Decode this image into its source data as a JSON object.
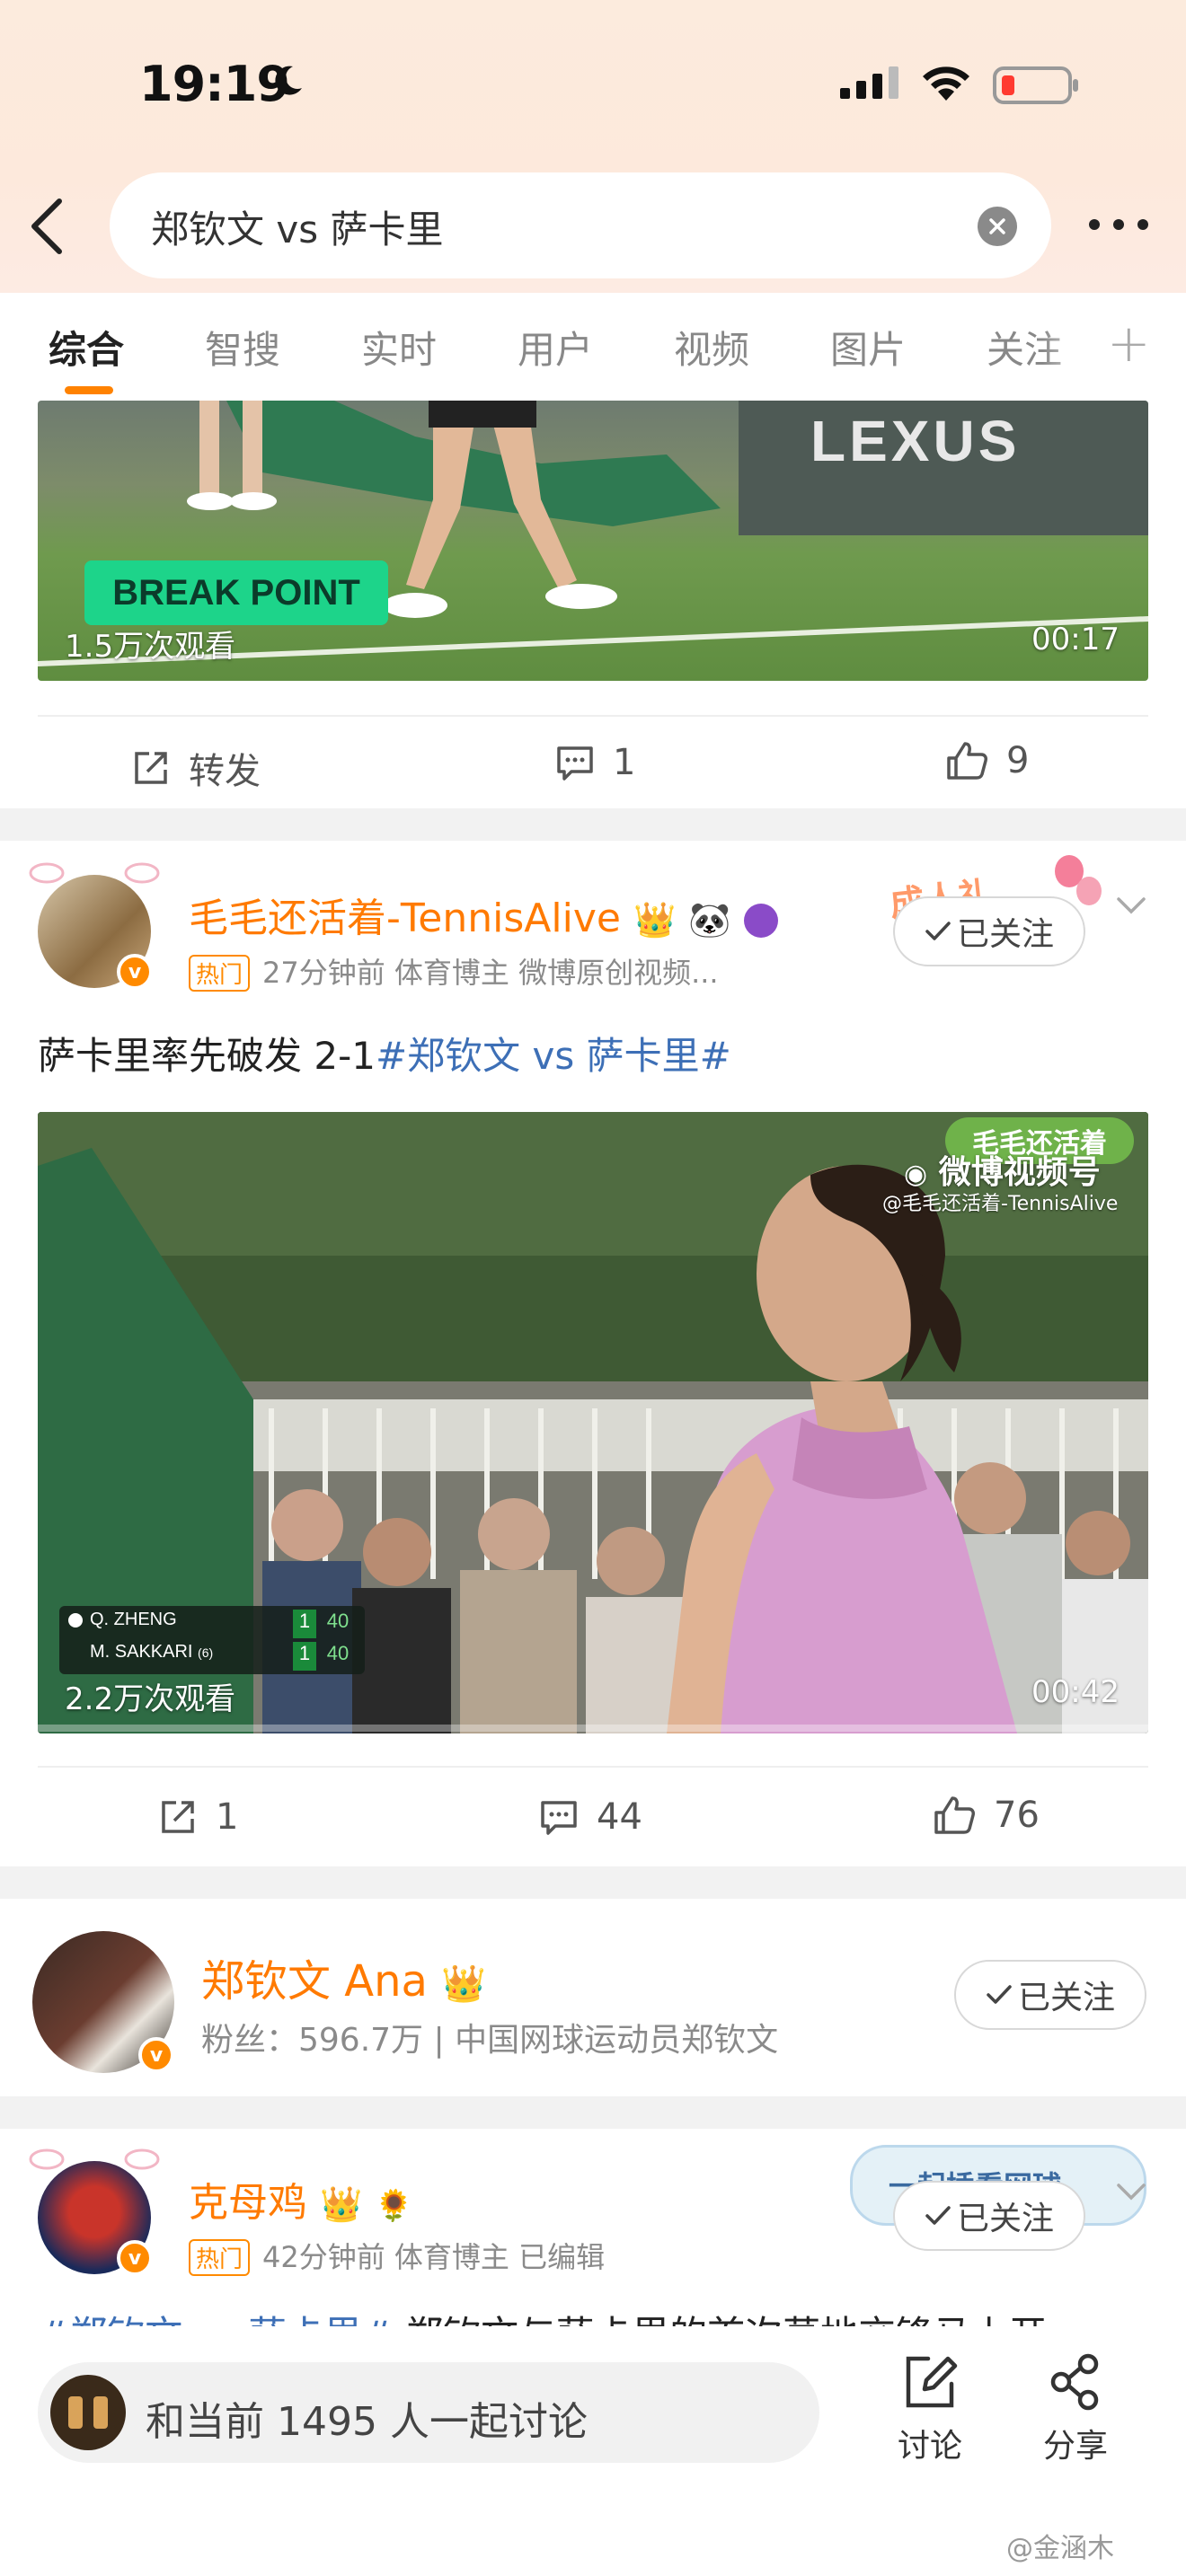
{
  "status_bar": {
    "time": "19:19"
  },
  "search": {
    "query": "郑钦文 vs 萨卡里"
  },
  "tabs": [
    {
      "label": "综合",
      "active": true
    },
    {
      "label": "智搜"
    },
    {
      "label": "实时"
    },
    {
      "label": "用户"
    },
    {
      "label": "视频"
    },
    {
      "label": "图片"
    },
    {
      "label": "关注"
    }
  ],
  "post1": {
    "video": {
      "overlay_label": "BREAK POINT",
      "brand": "LEXUS",
      "views": "1.5万次观看",
      "duration": "00:17"
    },
    "actions": {
      "repost": "转发",
      "comments": "1",
      "likes": "9"
    }
  },
  "post2": {
    "username": "毛毛还活着-TennisAlive",
    "hot_tag": "热门",
    "meta": "27分钟前  体育博主 微博原创视频...",
    "follow": "已关注",
    "deco": "成人礼",
    "text_plain": "萨卡里率先破发 2-1",
    "text_topic": "#郑钦文 vs 萨卡里#",
    "video": {
      "watermark_top": "毛毛还活着",
      "watermark_channel": "微博视频号",
      "watermark_handle": "@毛毛还活着-TennisAlive",
      "score_p1": "Q. ZHENG",
      "score_p2": "M. SAKKARI",
      "score_p2_seed": "(6)",
      "score_sets_p1": "1",
      "score_sets_p2": "1",
      "score_game_p1": "40",
      "score_game_p2": "40",
      "views": "2.2万次观看",
      "duration": "00:42"
    },
    "actions": {
      "reposts": "1",
      "comments": "44",
      "likes": "76"
    }
  },
  "user_card": {
    "name": "郑钦文 Ana",
    "fans": "粉丝：596.7万 | 中国网球运动员郑钦文",
    "follow": "已关注"
  },
  "post3": {
    "username": "克母鸡",
    "hot_tag": "热门",
    "meta": "42分钟前  体育博主 已编辑",
    "follow": "已关注",
    "deco": "一起捶看网球",
    "text_topic": "#郑钦文 vs 萨卡里#",
    "text_plain": " 郑钦文与萨卡里的首次草地交锋马上开"
  },
  "bottom_bar": {
    "discuss_placeholder": "和当前 1495 人一起讨论",
    "discuss_label": "讨论",
    "share_label": "分享"
  },
  "watermark": "@金涵木",
  "colors": {
    "accent": "#ff8200",
    "topic": "#3d6fb6",
    "username": "#ff7a00"
  }
}
